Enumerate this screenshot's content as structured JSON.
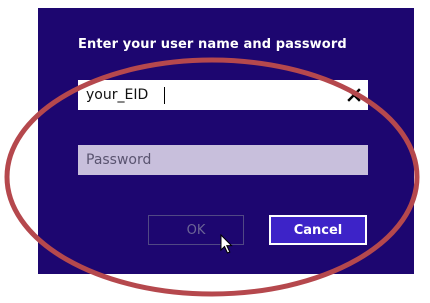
{
  "dialog": {
    "title": "Enter your user name and password",
    "username": {
      "value": "your_EID",
      "placeholder": ""
    },
    "password": {
      "value": "",
      "placeholder": "Password"
    },
    "ok_label": "OK",
    "cancel_label": "Cancel"
  },
  "colors": {
    "dialog_background": "#1d0670",
    "annotation_ring": "#b5484d",
    "cancel_button": "#3d23c8"
  }
}
